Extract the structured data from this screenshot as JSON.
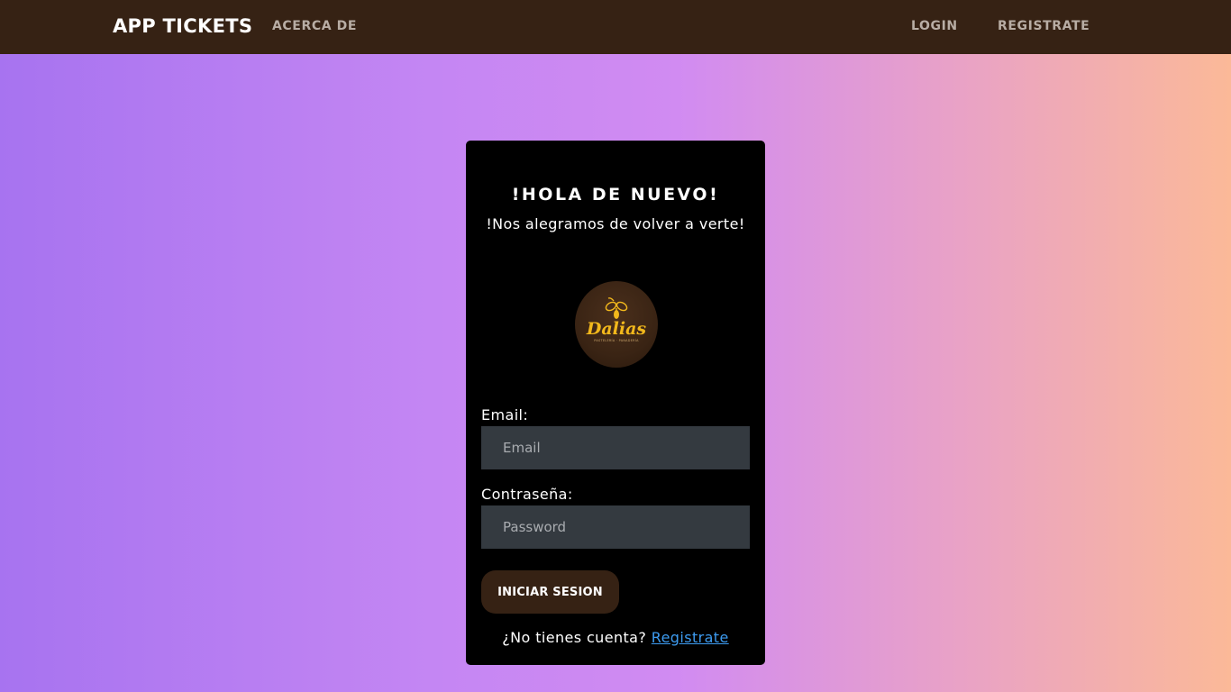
{
  "navbar": {
    "brand": "APP TICKETS",
    "links": [
      {
        "label": "ACERCA DE"
      },
      {
        "label": "LOGIN"
      },
      {
        "label": "REGISTRATE"
      }
    ]
  },
  "card": {
    "title": "!HOLA DE NUEVO!",
    "subtitle": "!Nos alegramos de volver a verte!",
    "logo": {
      "text": "Dalias",
      "tagline": "PASTELERÍA · PANADERÍA",
      "icon": "bee-icon"
    },
    "email": {
      "label": "Email:",
      "placeholder": "Email",
      "value": ""
    },
    "password": {
      "label": "Contraseña:",
      "placeholder": "Password",
      "value": ""
    },
    "submit_label": "INICIAR SESION",
    "footer": {
      "prompt": "¿No tienes cuenta?",
      "link_label": "Registrate"
    }
  },
  "colors": {
    "navbar_bg": "#362214",
    "card_bg": "#000000",
    "input_bg": "#343a40",
    "button_bg": "#362214",
    "link": "#3d9bf0",
    "logo_accent": "#f2b81c",
    "gradient": [
      "#a773f0",
      "#d18bf2",
      "#fbb998"
    ]
  }
}
